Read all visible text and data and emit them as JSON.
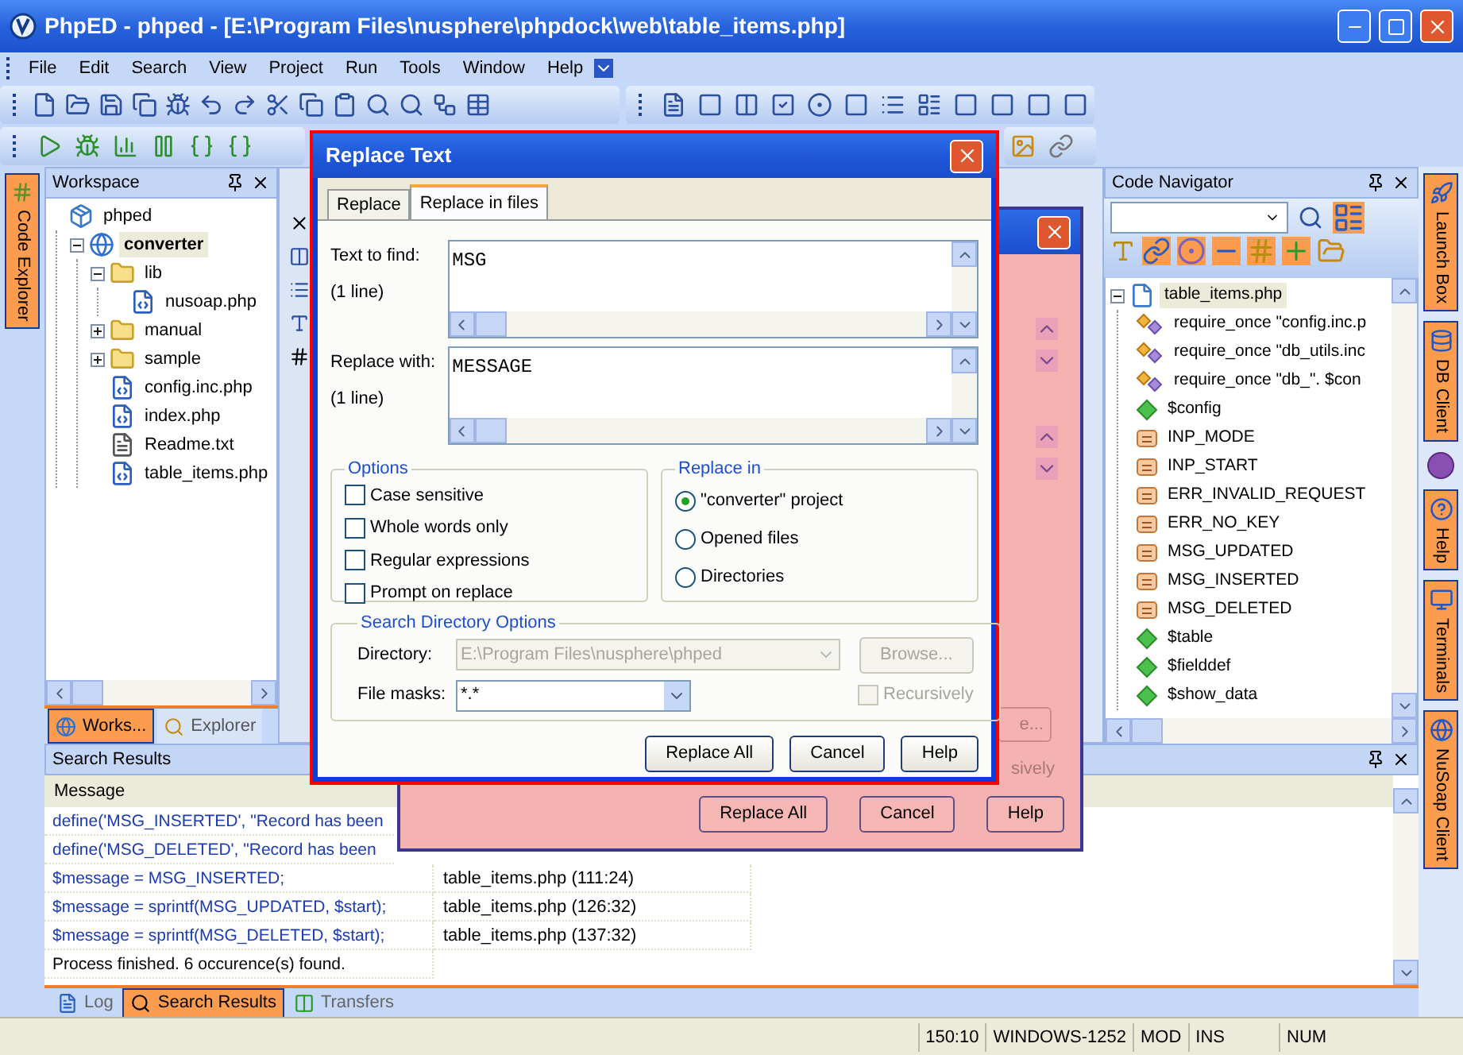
{
  "window": {
    "title": "PhpED - phped - [E:\\Program Files\\nusphere\\phpdock\\web\\table_items.php]"
  },
  "menu": [
    "File",
    "Edit",
    "Search",
    "View",
    "Project",
    "Run",
    "Tools",
    "Window",
    "Help"
  ],
  "left_dock_tabs": [
    {
      "label": "Code Explorer"
    }
  ],
  "workspace": {
    "title": "Workspace",
    "tree": [
      {
        "label": "phped",
        "kind": "workspace",
        "selected": false,
        "children": [
          {
            "label": "converter",
            "kind": "project",
            "selected": true,
            "expanded": true,
            "children": [
              {
                "label": "lib",
                "kind": "folder",
                "selected": false,
                "expanded": true,
                "children": [
                  {
                    "label": "nusoap.php",
                    "kind": "php",
                    "selected": false
                  }
                ]
              },
              {
                "label": "manual",
                "kind": "folder",
                "selected": false,
                "expanded": false
              },
              {
                "label": "sample",
                "kind": "folder",
                "selected": false,
                "expanded": false
              },
              {
                "label": "config.inc.php",
                "kind": "php",
                "selected": false
              },
              {
                "label": "index.php",
                "kind": "php",
                "selected": false
              },
              {
                "label": "Readme.txt",
                "kind": "txt",
                "selected": false
              },
              {
                "label": "table_items.php",
                "kind": "php",
                "selected": false
              }
            ]
          }
        ]
      }
    ],
    "tabs": [
      {
        "label": "Works...",
        "selected": true
      },
      {
        "label": "Explorer",
        "selected": false
      }
    ]
  },
  "code_navigator": {
    "title": "Code Navigator",
    "tree": [
      {
        "label": "table_items.php",
        "kind": "file",
        "selected": true,
        "expanded": true,
        "children": [
          {
            "label": "require_once \"config.inc.p",
            "kind": "include",
            "selected": false
          },
          {
            "label": "require_once \"db_utils.inc",
            "kind": "include",
            "selected": false
          },
          {
            "label": "require_once \"db_\". $con",
            "kind": "include",
            "selected": false
          },
          {
            "label": "$config",
            "kind": "variable",
            "selected": false
          },
          {
            "label": "INP_MODE",
            "kind": "constant",
            "selected": false
          },
          {
            "label": "INP_START",
            "kind": "constant",
            "selected": false
          },
          {
            "label": "ERR_INVALID_REQUEST",
            "kind": "constant",
            "selected": false
          },
          {
            "label": "ERR_NO_KEY",
            "kind": "constant",
            "selected": false
          },
          {
            "label": "MSG_UPDATED",
            "kind": "constant",
            "selected": false
          },
          {
            "label": "MSG_INSERTED",
            "kind": "constant",
            "selected": false
          },
          {
            "label": "MSG_DELETED",
            "kind": "constant",
            "selected": false
          },
          {
            "label": "$table",
            "kind": "variable",
            "selected": false
          },
          {
            "label": "$fielddef",
            "kind": "variable",
            "selected": false
          },
          {
            "label": "$show_data",
            "kind": "variable",
            "selected": false
          }
        ]
      }
    ]
  },
  "right_dock_tabs": [
    {
      "label": "Launch Box",
      "kind": "launch"
    },
    {
      "label": "DB Client",
      "kind": "db"
    },
    {
      "label": "Help",
      "kind": "help"
    },
    {
      "label": "Terminals",
      "kind": "terminal"
    },
    {
      "label": "NuSoap Client",
      "kind": "soap"
    }
  ],
  "search_results": {
    "title": "Search Results",
    "columns": [
      "Message"
    ],
    "rows": [
      {
        "message": "define('MSG_INSERTED', \"Record has been",
        "kind": "result"
      },
      {
        "message": "define('MSG_DELETED', \"Record has been",
        "kind": "result"
      },
      {
        "message": "$message = MSG_INSERTED;",
        "location": "table_items.php (111:24)",
        "kind": "result"
      },
      {
        "message": "$message = sprintf(MSG_UPDATED, $start);",
        "location": "table_items.php (126:32)",
        "kind": "result"
      },
      {
        "message": "$message = sprintf(MSG_DELETED, $start);",
        "location": "table_items.php (137:32)",
        "kind": "result"
      },
      {
        "message": "Process finished. 6 occurence(s) found.",
        "kind": "info"
      }
    ]
  },
  "bottom_tabs": [
    {
      "label": "Log",
      "selected": false
    },
    {
      "label": "Search Results",
      "selected": true
    },
    {
      "label": "Transfers",
      "selected": false
    }
  ],
  "status_bar": [
    "150:10",
    "WINDOWS-1252",
    "MOD",
    "INS",
    "NUM"
  ],
  "background_dialog": {
    "fragment_button": "e...",
    "fragment_text": "sively",
    "buttons": [
      "Replace All",
      "Cancel",
      "Help"
    ]
  },
  "dialog": {
    "title": "Replace Text",
    "tabs": [
      {
        "label": "Replace",
        "selected": false
      },
      {
        "label": "Replace in files",
        "selected": true
      }
    ],
    "find": {
      "label": "Text to find:",
      "note": "(1 line)",
      "value": "MSG"
    },
    "replace": {
      "label": "Replace with:",
      "note": "(1 line)",
      "value": "MESSAGE"
    },
    "options": {
      "title": "Options",
      "items": [
        {
          "label": "Case sensitive",
          "checked": false
        },
        {
          "label": "Whole words only",
          "checked": false
        },
        {
          "label": "Regular expressions",
          "checked": false
        },
        {
          "label": "Prompt on replace",
          "checked": false
        }
      ]
    },
    "replace_in": {
      "title": "Replace in",
      "items": [
        {
          "label": "\"converter\" project",
          "selected": true
        },
        {
          "label": "Opened files",
          "selected": false
        },
        {
          "label": "Directories",
          "selected": false
        }
      ]
    },
    "directory_options": {
      "title": "Search Directory Options",
      "directory": {
        "label": "Directory:",
        "value": "E:\\Program Files\\nusphere\\phped",
        "disabled": true
      },
      "browse": {
        "label": "Browse...",
        "disabled": true
      },
      "masks": {
        "label": "File masks:",
        "value": "*.*",
        "disabled": false
      },
      "recursively": {
        "label": "Recursively",
        "checked": false,
        "disabled": true
      }
    },
    "buttons": [
      "Replace All",
      "Cancel",
      "Help"
    ]
  }
}
